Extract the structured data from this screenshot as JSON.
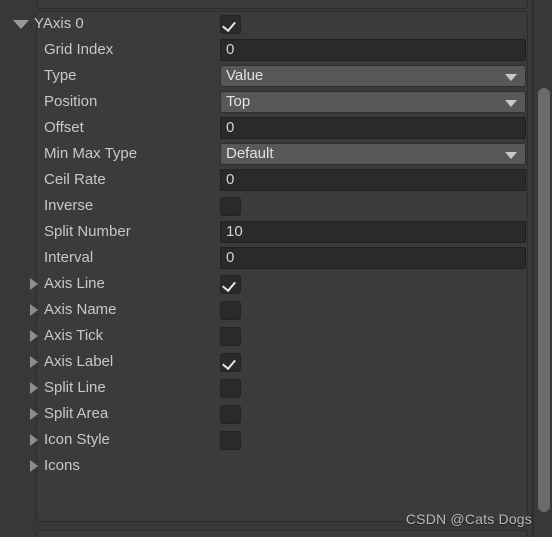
{
  "panel": {
    "header": {
      "label": "YAxis 0",
      "foldout_state": "expanded",
      "foldout_icon": "triangle-down-icon",
      "enabled_checkbox": true
    },
    "rows": [
      {
        "name": "grid-index",
        "label": "Grid Index",
        "control": "text",
        "value": "0",
        "indent": "child"
      },
      {
        "name": "type",
        "label": "Type",
        "control": "dropdown",
        "value": "Value",
        "indent": "child"
      },
      {
        "name": "position",
        "label": "Position",
        "control": "dropdown",
        "value": "Top",
        "indent": "child"
      },
      {
        "name": "offset",
        "label": "Offset",
        "control": "text",
        "value": "0",
        "indent": "child"
      },
      {
        "name": "min-max-type",
        "label": "Min Max Type",
        "control": "dropdown",
        "value": "Default",
        "indent": "child"
      },
      {
        "name": "ceil-rate",
        "label": "Ceil Rate",
        "control": "text",
        "value": "0",
        "indent": "child"
      },
      {
        "name": "inverse",
        "label": "Inverse",
        "control": "checkbox",
        "checked": false,
        "indent": "child"
      },
      {
        "name": "split-number",
        "label": "Split Number",
        "control": "text",
        "value": "10",
        "indent": "child"
      },
      {
        "name": "interval",
        "label": "Interval",
        "control": "text",
        "value": "0",
        "indent": "child"
      },
      {
        "name": "axis-line",
        "label": "Axis Line",
        "control": "checkbox",
        "checked": true,
        "indent": "foldout",
        "foldout_icon": "triangle-right-icon"
      },
      {
        "name": "axis-name",
        "label": "Axis Name",
        "control": "checkbox",
        "checked": false,
        "indent": "foldout",
        "foldout_icon": "triangle-right-icon"
      },
      {
        "name": "axis-tick",
        "label": "Axis Tick",
        "control": "checkbox",
        "checked": false,
        "indent": "foldout",
        "foldout_icon": "triangle-right-icon"
      },
      {
        "name": "axis-label",
        "label": "Axis Label",
        "control": "checkbox",
        "checked": true,
        "indent": "foldout",
        "foldout_icon": "triangle-right-icon"
      },
      {
        "name": "split-line",
        "label": "Split Line",
        "control": "checkbox",
        "checked": false,
        "indent": "foldout",
        "foldout_icon": "triangle-right-icon"
      },
      {
        "name": "split-area",
        "label": "Split Area",
        "control": "checkbox",
        "checked": false,
        "indent": "foldout",
        "foldout_icon": "triangle-right-icon"
      },
      {
        "name": "icon-style",
        "label": "Icon Style",
        "control": "checkbox",
        "checked": false,
        "indent": "foldout",
        "foldout_icon": "triangle-right-icon"
      },
      {
        "name": "icons",
        "label": "Icons",
        "control": "none",
        "indent": "foldout",
        "foldout_icon": "triangle-right-icon"
      }
    ]
  },
  "watermark": {
    "text": "CSDN @Cats Dogs"
  },
  "scrollbar": {
    "orientation": "vertical",
    "thumb_visible": true
  },
  "colors": {
    "window_bg": "#383838",
    "panel_bg": "#3b3b3b",
    "panel_border": "#2d2d2d",
    "label_text": "#c8c8c8",
    "input_bg": "#2a2a2a",
    "dropdown_bg": "#585858",
    "value_text": "#d4d4d4",
    "triangle": "#8d8d8d",
    "scroll_thumb": "#6b6b6b"
  }
}
